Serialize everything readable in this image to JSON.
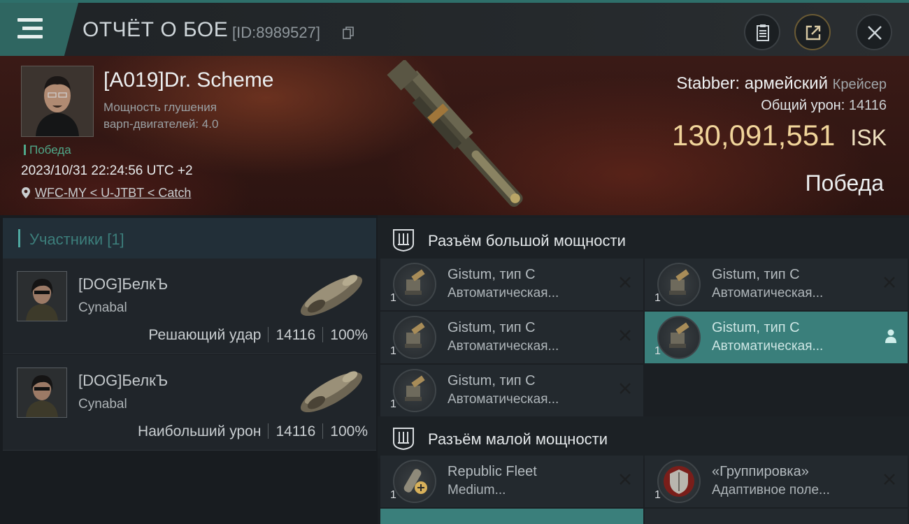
{
  "header": {
    "title": "ОТЧЁТ О БОЕ",
    "report_id": "[ID:8989527]"
  },
  "victim": {
    "name": "[A019]Dr. Scheme",
    "info_line1": "Мощность глушения",
    "info_line2": "варп-двигателей: 4.0",
    "result_tag": "Победа",
    "timestamp": "2023/10/31 22:24:56 UTC +2",
    "location": "WFC-MY < U-JTBT < Catch",
    "ship_name": "Stabber: армейский",
    "ship_class": "Крейсер",
    "total_damage_label": "Общий урон:",
    "total_damage": "14116",
    "isk_value": "130,091,551",
    "isk_currency": "ISK",
    "result": "Победа"
  },
  "participants": {
    "header": "Участники [1]",
    "items": [
      {
        "name": "[DOG]БелкЪ",
        "ship": "Cynabal",
        "role": "Решающий удар",
        "damage": "14116",
        "percent": "100%"
      },
      {
        "name": "[DOG]БелкЪ",
        "ship": "Cynabal",
        "role": "Наибольший урон",
        "damage": "14116",
        "percent": "100%"
      }
    ]
  },
  "slots": {
    "high": {
      "title": "Разъём большой мощности",
      "modules": [
        {
          "qty": "1",
          "line1": "Gistum, тип C",
          "line2": "Автоматическая..."
        },
        {
          "qty": "1",
          "line1": "Gistum, тип C",
          "line2": "Автоматическая..."
        },
        {
          "qty": "1",
          "line1": "Gistum, тип C",
          "line2": "Автоматическая..."
        },
        {
          "qty": "1",
          "line1": "Gistum, тип C",
          "line2": "Автоматическая..."
        },
        {
          "qty": "1",
          "line1": "Gistum, тип C",
          "line2": "Автоматическая..."
        }
      ]
    },
    "low": {
      "title": "Разъём малой мощности",
      "modules": [
        {
          "qty": "1",
          "line1": "Republic Fleet",
          "line2": "Medium..."
        },
        {
          "qty": "1",
          "line1": "«Группировка»",
          "line2": "Адаптивное поле..."
        }
      ]
    }
  },
  "colors": {
    "accent": "#2f6661",
    "selected": "#3a7f7b",
    "isk": "#f0d49a",
    "victory": "#4fa889"
  }
}
